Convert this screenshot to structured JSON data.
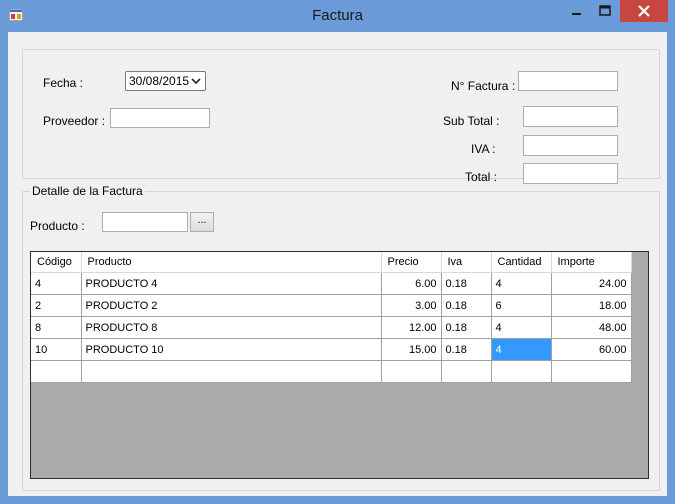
{
  "window": {
    "title": "Factura"
  },
  "header": {
    "fecha_label": "Fecha :",
    "fecha_value": "30/08/2015",
    "proveedor_label": "Proveedor :",
    "proveedor_value": "",
    "nro_factura_label": "N° Factura :",
    "nro_factura_value": "",
    "subtotal_label": "Sub Total :",
    "subtotal_value": "",
    "iva_label": "IVA :",
    "iva_value": "",
    "total_label": "Total :",
    "total_value": ""
  },
  "detail": {
    "legend": "Detalle de la Factura",
    "producto_label": "Producto :",
    "producto_value": "",
    "browse_label": "...",
    "columns": [
      "Código",
      "Producto",
      "Precio",
      "Iva",
      "Cantidad",
      "Importe"
    ],
    "rows": [
      [
        "4",
        "PRODUCTO 4",
        "6.00",
        "0.18",
        "4",
        "24.00"
      ],
      [
        "2",
        "PRODUCTO 2",
        "3.00",
        "0.18",
        "6",
        "18.00"
      ],
      [
        "8",
        "PRODUCTO 8",
        "12.00",
        "0.18",
        "4",
        "48.00"
      ],
      [
        "10",
        "PRODUCTO 10",
        "15.00",
        "0.18",
        "4",
        "60.00"
      ]
    ]
  },
  "colors": {
    "titlebar": "#6b9bd8",
    "close_button": "#c7463f",
    "selected_cell": "#3399ff",
    "grid_background": "#ababab"
  }
}
